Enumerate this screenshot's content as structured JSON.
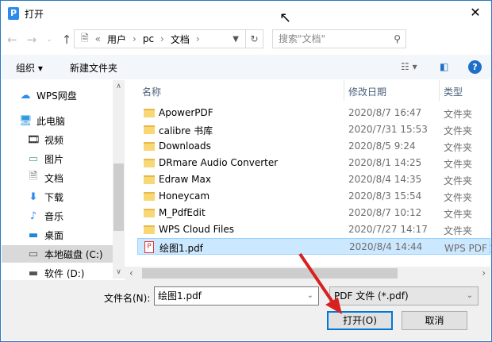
{
  "window": {
    "title": "打开",
    "close": "✕"
  },
  "address": {
    "overflow": "«",
    "crumbs": [
      "用户",
      "pc",
      "文档"
    ]
  },
  "search": {
    "placeholder": "搜索\"文档\""
  },
  "toolbar": {
    "organize": "组织 ▾",
    "new_folder": "新建文件夹",
    "help": "?"
  },
  "nav": [
    {
      "label": "WPS网盘",
      "icon": "cloud-icon"
    },
    {
      "label": "此电脑",
      "icon": "computer-icon"
    },
    {
      "label": "视频",
      "icon": "video-icon"
    },
    {
      "label": "图片",
      "icon": "picture-icon"
    },
    {
      "label": "文档",
      "icon": "document-icon"
    },
    {
      "label": "下载",
      "icon": "download-icon"
    },
    {
      "label": "音乐",
      "icon": "music-icon"
    },
    {
      "label": "桌面",
      "icon": "desktop-icon"
    },
    {
      "label": "本地磁盘 (C:)",
      "icon": "drive-icon"
    },
    {
      "label": "软件 (D:)",
      "icon": "drive-icon"
    }
  ],
  "columns": {
    "name": "名称",
    "date": "修改日期",
    "type": "类型"
  },
  "files": [
    {
      "name": "ApowerPDF",
      "date": "2020/8/7 16:47",
      "type": "文件夹",
      "kind": "folder"
    },
    {
      "name": "calibre 书库",
      "date": "2020/7/31 15:53",
      "type": "文件夹",
      "kind": "folder"
    },
    {
      "name": "Downloads",
      "date": "2020/8/5 9:24",
      "type": "文件夹",
      "kind": "folder"
    },
    {
      "name": "DRmare Audio Converter",
      "date": "2020/8/1 14:25",
      "type": "文件夹",
      "kind": "folder"
    },
    {
      "name": "Edraw Max",
      "date": "2020/8/4 14:35",
      "type": "文件夹",
      "kind": "folder"
    },
    {
      "name": "Honeycam",
      "date": "2020/8/3 15:54",
      "type": "文件夹",
      "kind": "folder"
    },
    {
      "name": "M_PdfEdit",
      "date": "2020/8/7 10:12",
      "type": "文件夹",
      "kind": "folder"
    },
    {
      "name": "WPS Cloud Files",
      "date": "2020/7/27 14:17",
      "type": "文件夹",
      "kind": "folder"
    },
    {
      "name": "绘图1.pdf",
      "date": "2020/8/4 14:44",
      "type": "WPS PDF 文",
      "kind": "pdf"
    }
  ],
  "footer": {
    "filename_label": "文件名(N):",
    "filename_value": "绘图1.pdf",
    "filetype": "PDF 文件 (*.pdf)",
    "open": "打开(O)",
    "cancel": "取消"
  }
}
